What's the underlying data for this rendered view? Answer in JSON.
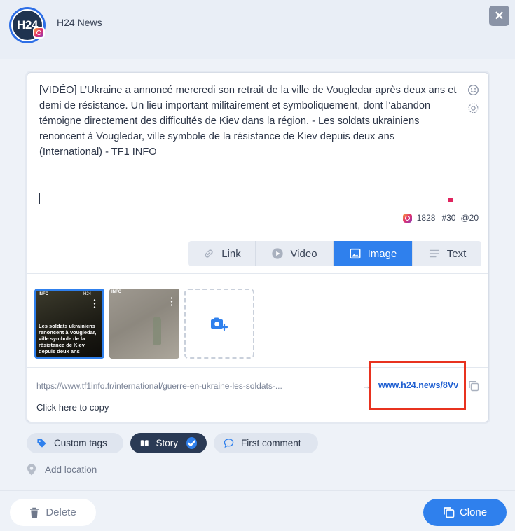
{
  "header": {
    "avatar_text": "H24",
    "brand_name": "H24 News",
    "close_label": "✕"
  },
  "post": {
    "text": "[VIDÉO] L’Ukraine a annoncé mercredi son retrait de la ville de Vougledar après deux ans et demi de résistance. Un lieu important militairement et symboliquement, dont l’abandon témoigne directement des difficultés de Kiev dans la région. - Les soldats ukrainiens renoncent à Vougledar, ville symbole de la résistance de Kiev depuis deux ans (International) - TF1 INFO",
    "stats": {
      "chars": "1828",
      "hashtags": "#30",
      "mentions": "@20"
    }
  },
  "tabs": [
    {
      "label": "Link",
      "icon": "link-icon",
      "active": false
    },
    {
      "label": "Video",
      "icon": "play-circle-icon",
      "active": false
    },
    {
      "label": "Image",
      "icon": "image-icon",
      "active": true
    },
    {
      "label": "Text",
      "icon": "text-lines-icon",
      "active": false
    }
  ],
  "media": {
    "thumb1": {
      "tag": "INFO",
      "brand": "H24",
      "caption": "Les soldats ukrainiens renoncent à Vougledar, ville symbole de la résistance de Kiev depuis deux ans"
    },
    "thumb2": {
      "tag": "INFO"
    }
  },
  "link": {
    "source_url": "https://www.tf1info.fr/international/guerre-en-ukraine-les-soldats-...",
    "arrow": "→",
    "short_url": "www.h24.news/8Vv",
    "copy_hint": "Click here to copy"
  },
  "options": {
    "custom_tags": "Custom tags",
    "story": "Story",
    "first_comment": "First comment",
    "add_location": "Add location"
  },
  "footer": {
    "delete_label": "Delete",
    "clone_label": "Clone"
  },
  "colors": {
    "accent": "#2f80ed",
    "story_pill": "#2a3a55",
    "highlight": "#e8321f"
  }
}
